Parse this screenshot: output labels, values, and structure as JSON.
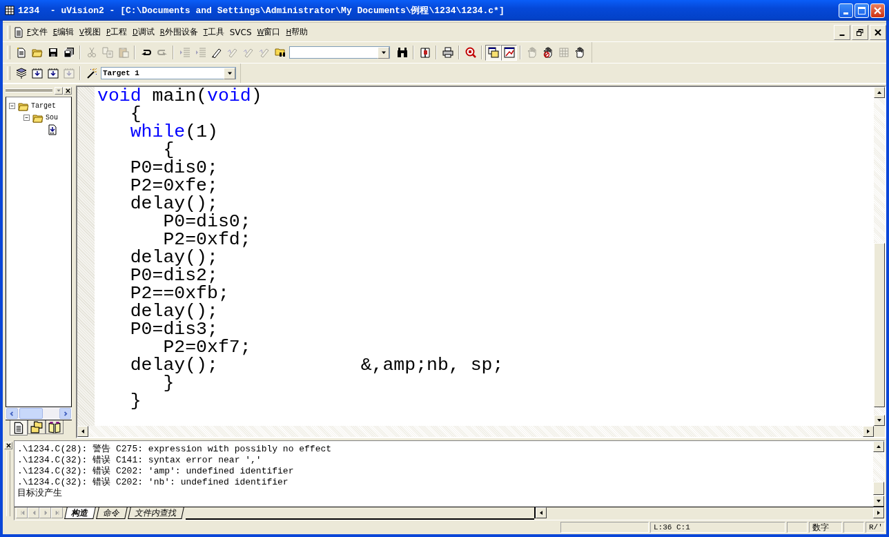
{
  "window": {
    "title": "1234  - uVision2 - [C:\\Documents and Settings\\Administrator\\My Documents\\例程\\1234\\1234.c*]"
  },
  "menu": [
    {
      "key": "F",
      "label": "文件"
    },
    {
      "key": "E",
      "label": "编辑"
    },
    {
      "key": "V",
      "label": "视图"
    },
    {
      "key": "P",
      "label": "工程"
    },
    {
      "key": "D",
      "label": "调试"
    },
    {
      "key": "R",
      "label": "外围设备"
    },
    {
      "key": "T",
      "label": "工具"
    },
    {
      "label": "SVCS"
    },
    {
      "key": "W",
      "label": "窗口"
    },
    {
      "key": "H",
      "label": "帮助"
    }
  ],
  "toolbar_1": [
    {
      "disabled": false,
      "pressed": false
    },
    {
      "disabled": false,
      "pressed": false
    },
    {
      "disabled": false,
      "pressed": false
    },
    {
      "disabled": false,
      "pressed": false
    },
    {
      "disabled": true,
      "pressed": false
    },
    {
      "disabled": true,
      "pressed": false
    },
    {
      "disabled": true,
      "pressed": false
    },
    {
      "disabled": false,
      "pressed": false
    },
    {
      "disabled": true,
      "pressed": false
    },
    {
      "disabled": true,
      "pressed": false
    },
    {
      "disabled": true,
      "pressed": false
    },
    {
      "disabled": false,
      "pressed": false
    },
    {
      "disabled": true,
      "pressed": false
    },
    {
      "disabled": true,
      "pressed": false
    },
    {
      "disabled": true,
      "pressed": false
    },
    {
      "disabled": false,
      "pressed": false
    },
    {
      "disabled": false,
      "pressed": false
    },
    {
      "disabled": false,
      "pressed": false
    },
    {
      "disabled": false,
      "pressed": false
    },
    {
      "disabled": false,
      "pressed": false
    },
    {
      "disabled": false,
      "pressed": true
    },
    {
      "disabled": false,
      "pressed": true
    },
    {
      "disabled": true,
      "pressed": false
    },
    {
      "disabled": false,
      "pressed": false
    },
    {
      "disabled": true,
      "pressed": false
    },
    {
      "disabled": false,
      "pressed": false
    }
  ],
  "toolbar_2": {
    "buttons": [
      {
        "disabled": false
      },
      {
        "disabled": false
      },
      {
        "disabled": false
      },
      {
        "disabled": true
      }
    ],
    "target": "Target 1"
  },
  "project_tree": [
    {
      "kind": "folder",
      "label": "Target",
      "expanded": true,
      "children": [
        {
          "kind": "folder",
          "label": "Sou",
          "expanded": true,
          "children": [
            {
              "kind": "file"
            }
          ]
        }
      ]
    }
  ],
  "project_tabs": [
    {
      "selected": true
    },
    {
      "selected": false
    },
    {
      "selected": false
    }
  ],
  "editor": {
    "lines": [
      [
        {
          "kind": "keyword",
          "text": "void"
        },
        {
          "kind": "plain",
          "text": " main("
        },
        {
          "kind": "keyword",
          "text": "void"
        },
        {
          "kind": "plain",
          "text": ")"
        }
      ],
      [
        {
          "kind": "plain",
          "text": "   {"
        }
      ],
      [
        {
          "kind": "keyword",
          "text": "   while"
        },
        {
          "kind": "plain",
          "text": "(1)"
        }
      ],
      [
        {
          "kind": "plain",
          "text": "      {"
        }
      ],
      [
        {
          "kind": "plain",
          "text": "   P0=dis0;"
        }
      ],
      [
        {
          "kind": "plain",
          "text": "   P2=0xfe;"
        }
      ],
      [
        {
          "kind": "plain",
          "text": "   delay();"
        }
      ],
      [
        {
          "kind": "plain",
          "text": "      P0=dis0;"
        }
      ],
      [
        {
          "kind": "plain",
          "text": "      P2=0xfd;"
        }
      ],
      [
        {
          "kind": "plain",
          "text": "   delay();"
        }
      ],
      [
        {
          "kind": "plain",
          "text": "   P0=dis2;"
        }
      ],
      [
        {
          "kind": "plain",
          "text": "   P2==0xfb;"
        }
      ],
      [
        {
          "kind": "plain",
          "text": "   delay();"
        }
      ],
      [
        {
          "kind": "plain",
          "text": "   P0=dis3;"
        }
      ],
      [
        {
          "kind": "plain",
          "text": "      P2=0xf7;"
        }
      ],
      [
        {
          "kind": "plain",
          "text": "   delay();             &,amp;nb, sp;"
        }
      ],
      [
        {
          "kind": "plain",
          "text": "      }"
        }
      ],
      [
        {
          "kind": "plain",
          "text": "   }"
        }
      ]
    ]
  },
  "output": {
    "lines": [
      ".\\1234.C(28): 警告 C275: expression with possibly no effect",
      ".\\1234.C(32): 错误 C141: syntax error near ','",
      ".\\1234.C(32): 错误 C202: 'amp': undefined identifier",
      ".\\1234.C(32): 错误 C202: 'nb': undefined identifier",
      "目标没产生"
    ],
    "tabs": [
      {
        "label": "构造",
        "selected": true
      },
      {
        "label": "命令",
        "selected": false
      },
      {
        "label": "文件内查找",
        "selected": false
      }
    ]
  },
  "status_bar": {
    "position": "L:36 C:1",
    "num_lock": "数字",
    "mode": "R/'"
  }
}
